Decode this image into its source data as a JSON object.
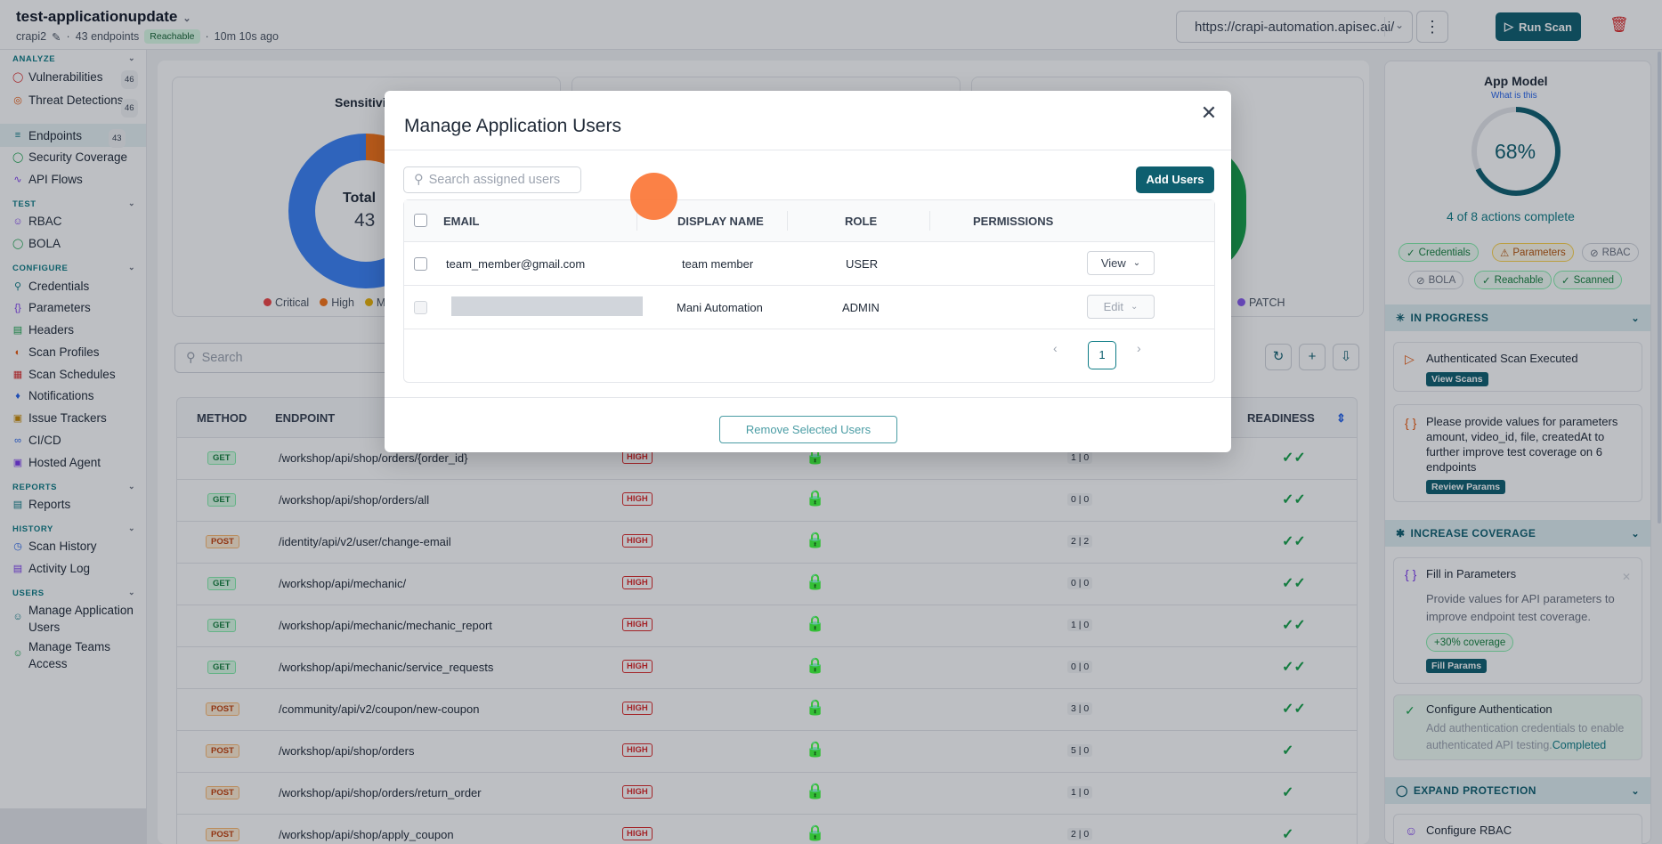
{
  "header": {
    "app_name": "test-applicationupdate",
    "workspace": "crapi2",
    "endpoints": "43 endpoints",
    "status": "Reachable",
    "updated": "10m 10s ago",
    "url": "https://crapi-automation.apisec.ai/",
    "run_scan": "Run Scan"
  },
  "sidebar": {
    "analyze": "ANALYZE",
    "vulnerabilities": "Vulnerabilities",
    "vulnerabilities_count": "46",
    "threat": "Threat Detections",
    "threat_count": "46",
    "endpoints": "Endpoints",
    "endpoints_count": "43",
    "security_coverage": "Security Coverage",
    "api_flows": "API Flows",
    "test": "TEST",
    "rbac": "RBAC",
    "bola": "BOLA",
    "configure": "CONFIGURE",
    "credentials": "Credentials",
    "parameters": "Parameters",
    "headers": "Headers",
    "scan_profiles": "Scan Profiles",
    "scan_schedules": "Scan Schedules",
    "notifications": "Notifications",
    "issue_trackers": "Issue Trackers",
    "cicd": "CI/CD",
    "hosted_agent": "Hosted Agent",
    "reports_h": "REPORTS",
    "reports": "Reports",
    "history": "HISTORY",
    "scan_history": "Scan History",
    "activity_log": "Activity Log",
    "users": "USERS",
    "manage_app_users": "Manage Application Users",
    "manage_teams": "Manage Teams Access"
  },
  "main": {
    "sensitivity_title": "Sensitivi",
    "total_label": "Total",
    "total_value": "43",
    "legend": [
      "Critical",
      "High",
      "M"
    ],
    "patch": "PATCH",
    "search_placeholder": "Search",
    "columns": {
      "method": "METHOD",
      "endpoint": "ENDPOINT",
      "readiness": "READINESS"
    },
    "rows": [
      {
        "method": "GET",
        "endpoint": "/workshop/api/shop/orders/{order_id}",
        "risk": "HIGH",
        "ratio": "1 | 0"
      },
      {
        "method": "GET",
        "endpoint": "/workshop/api/shop/orders/all",
        "risk": "HIGH",
        "ratio": "0 | 0"
      },
      {
        "method": "POST",
        "endpoint": "/identity/api/v2/user/change-email",
        "risk": "HIGH",
        "ratio": "2 | 2"
      },
      {
        "method": "GET",
        "endpoint": "/workshop/api/mechanic/",
        "risk": "HIGH",
        "ratio": "0 | 0"
      },
      {
        "method": "GET",
        "endpoint": "/workshop/api/mechanic/mechanic_report",
        "risk": "HIGH",
        "ratio": "1 | 0"
      },
      {
        "method": "GET",
        "endpoint": "/workshop/api/mechanic/service_requests",
        "risk": "HIGH",
        "ratio": "0 | 0"
      },
      {
        "method": "POST",
        "endpoint": "/community/api/v2/coupon/new-coupon",
        "risk": "HIGH",
        "ratio": "3 | 0"
      },
      {
        "method": "POST",
        "endpoint": "/workshop/api/shop/orders",
        "risk": "HIGH",
        "ratio": "5 | 0"
      },
      {
        "method": "POST",
        "endpoint": "/workshop/api/shop/orders/return_order",
        "risk": "HIGH",
        "ratio": "1 | 0"
      },
      {
        "method": "POST",
        "endpoint": "/workshop/api/shop/apply_coupon",
        "risk": "HIGH",
        "ratio": "2 | 0"
      }
    ]
  },
  "app_model": {
    "title": "App Model",
    "what": "What is this",
    "percent": "68%",
    "progress_fraction": 0.68,
    "progress": "4 of 8 actions complete",
    "chips": [
      "Credentials",
      "Parameters",
      "RBAC",
      "BOLA",
      "Reachable",
      "Scanned"
    ],
    "in_progress": "IN PROGRESS",
    "auth_scan": "Authenticated Scan Executed",
    "view_scans": "View Scans",
    "params_msg": "Please provide values for parameters amount, video_id, file, createdAt to further improve test coverage on 6 endpoints",
    "review_params": "Review Params",
    "increase": "INCREASE COVERAGE",
    "fill_title": "Fill in Parameters",
    "fill_desc": "Provide values for API parameters to improve endpoint test coverage.",
    "coverage_chip": "+30% coverage",
    "fill_params": "Fill Params",
    "config_auth": "Configure Authentication",
    "config_auth_desc": "Add authentication credentials to enable authenticated API testing.",
    "completed": "Completed",
    "expand": "EXPAND PROTECTION",
    "config_rbac": "Configure RBAC"
  },
  "modal": {
    "title": "Manage Application Users",
    "search_placeholder": "Search assigned users",
    "add_users": "Add Users",
    "columns": {
      "email": "EMAIL",
      "display_name": "DISPLAY NAME",
      "role": "ROLE",
      "permissions": "PERMISSIONS"
    },
    "users": [
      {
        "email": "team_member@gmail.com",
        "display_name": "team member",
        "role": "USER",
        "permission": "View"
      },
      {
        "email": "",
        "display_name": "Mani Automation",
        "role": "ADMIN",
        "permission": "Edit"
      }
    ],
    "page": "1",
    "remove": "Remove Selected Users"
  }
}
